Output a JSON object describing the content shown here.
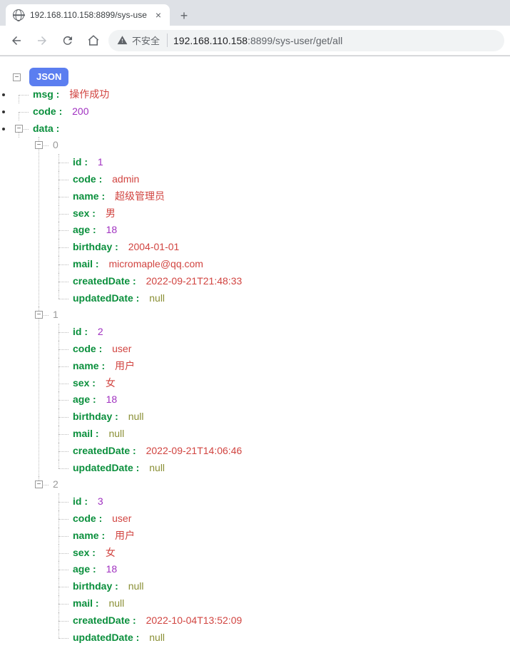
{
  "browser": {
    "tab_title": "192.168.110.158:8899/sys-use",
    "insecure_label": "不安全",
    "url_host": "192.168.110.158",
    "url_port": ":8899",
    "url_path": "/sys-user/get/all"
  },
  "badge": "JSON",
  "response": {
    "msg": {
      "key": "msg",
      "value": "操作成功",
      "type": "str"
    },
    "code": {
      "key": "code",
      "value": "200",
      "type": "num"
    },
    "data_key": "data",
    "data": [
      {
        "index": "0",
        "fields": [
          {
            "key": "id",
            "value": "1",
            "type": "num"
          },
          {
            "key": "code",
            "value": "admin",
            "type": "str"
          },
          {
            "key": "name",
            "value": "超级管理员",
            "type": "str"
          },
          {
            "key": "sex",
            "value": "男",
            "type": "str"
          },
          {
            "key": "age",
            "value": "18",
            "type": "num"
          },
          {
            "key": "birthday",
            "value": "2004-01-01",
            "type": "str"
          },
          {
            "key": "mail",
            "value": "micromaple@qq.com",
            "type": "str"
          },
          {
            "key": "createdDate",
            "value": "2022-09-21T21:48:33",
            "type": "str"
          },
          {
            "key": "updatedDate",
            "value": "null",
            "type": "null"
          }
        ]
      },
      {
        "index": "1",
        "fields": [
          {
            "key": "id",
            "value": "2",
            "type": "num"
          },
          {
            "key": "code",
            "value": "user",
            "type": "str"
          },
          {
            "key": "name",
            "value": "用户",
            "type": "str"
          },
          {
            "key": "sex",
            "value": "女",
            "type": "str"
          },
          {
            "key": "age",
            "value": "18",
            "type": "num"
          },
          {
            "key": "birthday",
            "value": "null",
            "type": "null"
          },
          {
            "key": "mail",
            "value": "null",
            "type": "null"
          },
          {
            "key": "createdDate",
            "value": "2022-09-21T14:06:46",
            "type": "str"
          },
          {
            "key": "updatedDate",
            "value": "null",
            "type": "null"
          }
        ]
      },
      {
        "index": "2",
        "fields": [
          {
            "key": "id",
            "value": "3",
            "type": "num"
          },
          {
            "key": "code",
            "value": "user",
            "type": "str"
          },
          {
            "key": "name",
            "value": "用户",
            "type": "str"
          },
          {
            "key": "sex",
            "value": "女",
            "type": "str"
          },
          {
            "key": "age",
            "value": "18",
            "type": "num"
          },
          {
            "key": "birthday",
            "value": "null",
            "type": "null"
          },
          {
            "key": "mail",
            "value": "null",
            "type": "null"
          },
          {
            "key": "createdDate",
            "value": "2022-10-04T13:52:09",
            "type": "str"
          },
          {
            "key": "updatedDate",
            "value": "null",
            "type": "null"
          }
        ]
      }
    ]
  }
}
